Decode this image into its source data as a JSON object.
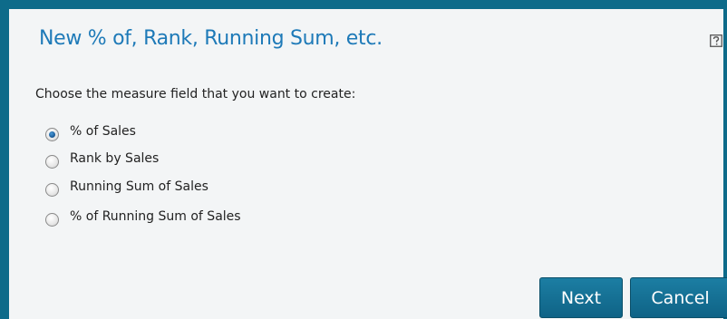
{
  "dialog": {
    "title": "New % of, Rank, Running Sum, etc.",
    "help_icon": "help-icon",
    "prompt": "Choose the measure field that you want to create:",
    "options": [
      {
        "label": "% of Sales",
        "selected": true
      },
      {
        "label": "Rank by Sales",
        "selected": false
      },
      {
        "label": "Running Sum of Sales",
        "selected": false
      },
      {
        "label": "% of Running Sum of Sales",
        "selected": false
      }
    ],
    "buttons": {
      "next_label": "Next",
      "cancel_label": "Cancel"
    }
  },
  "colors": {
    "accent": "#0d6b8a",
    "title": "#1e7ab8",
    "button": "#13709a"
  }
}
